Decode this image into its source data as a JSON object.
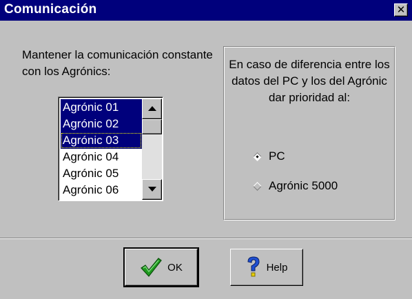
{
  "window": {
    "title": "Comunicación",
    "close_symbol": "✕"
  },
  "left_panel": {
    "label": "Mantener la comunicación constante con los Agrónics:",
    "list": {
      "items": [
        {
          "label": "Agrónic 01",
          "selected": true
        },
        {
          "label": "Agrónic 02",
          "selected": true
        },
        {
          "label": "Agrónic 03",
          "selected": true
        },
        {
          "label": "Agrónic 04",
          "selected": false
        },
        {
          "label": "Agrónic 05",
          "selected": false
        },
        {
          "label": "Agrónic 06",
          "selected": false
        }
      ],
      "focused_index": 2
    }
  },
  "priority_group": {
    "text": "En caso de diferencia entre los datos del PC y los del Agrónic dar prioridad al:",
    "options": [
      {
        "label": "PC",
        "checked": true
      },
      {
        "label": "Agrónic 5000",
        "checked": false
      }
    ]
  },
  "buttons": {
    "ok_label": "OK",
    "ok_icon": "checkmark-icon",
    "help_label": "Help",
    "help_icon": "question-mark-icon"
  },
  "colors": {
    "title_bar": "#00007c",
    "face": "#c0c0c0",
    "selection": "#00007c",
    "check_green": "#1e9a1e",
    "help_blue": "#1f4fd1",
    "help_yellow": "#e8d000"
  }
}
